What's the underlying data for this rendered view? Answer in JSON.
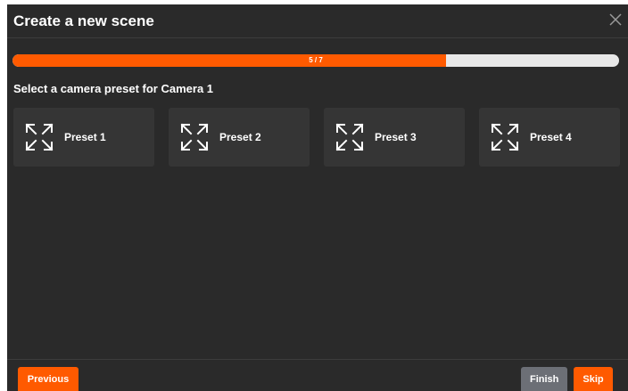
{
  "dialog": {
    "title": "Create a new scene",
    "close_icon": "close-icon"
  },
  "progress": {
    "label": "5 / 7",
    "current": 5,
    "total": 7,
    "fraction": 0.714,
    "fill_color": "#ff5a00",
    "track_color": "#e8e8e8"
  },
  "subtitle": "Select a camera preset for Camera 1",
  "presets": [
    {
      "label": "Preset 1",
      "icon": "expand-arrows-icon"
    },
    {
      "label": "Preset 2",
      "icon": "expand-arrows-icon"
    },
    {
      "label": "Preset 3",
      "icon": "expand-arrows-icon"
    },
    {
      "label": "Preset 4",
      "icon": "expand-arrows-icon"
    }
  ],
  "footer": {
    "previous_label": "Previous",
    "finish_label": "Finish",
    "skip_label": "Skip"
  },
  "colors": {
    "accent": "#ff5a00",
    "background": "#2a2a2a",
    "tile": "#353535",
    "secondary_button": "#6c6f76"
  }
}
